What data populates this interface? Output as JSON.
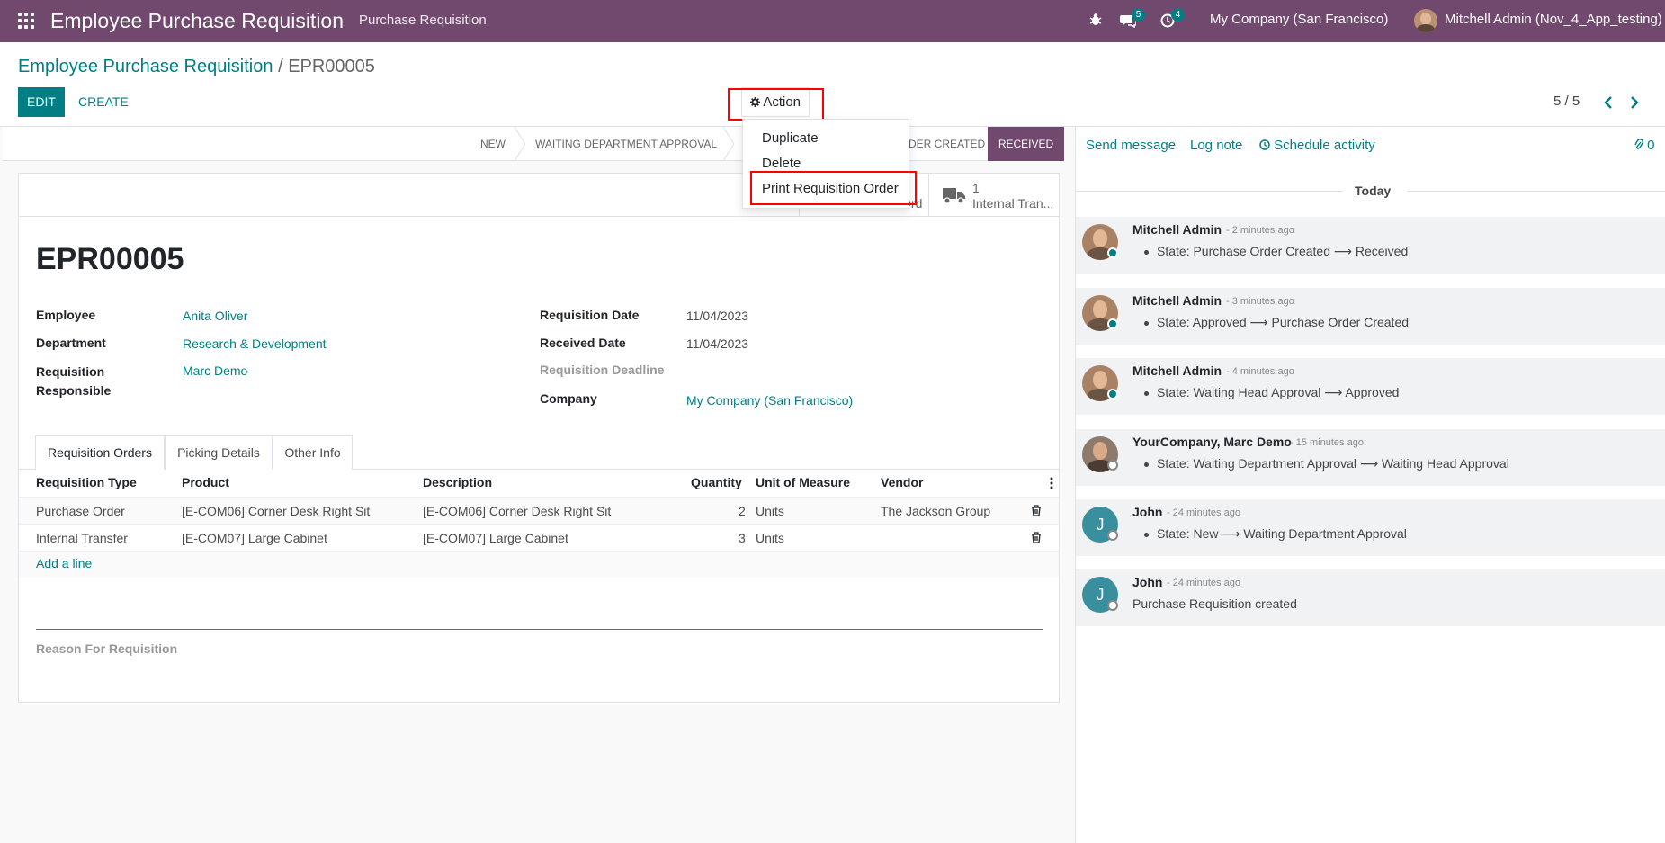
{
  "navbar": {
    "app_title": "Employee Purchase Requisition",
    "menu": "Purchase Requisition",
    "chat_count": "5",
    "activity_count": "4",
    "company": "My Company (San Francisco)",
    "user": "Mitchell Admin (Nov_4_App_testing)"
  },
  "breadcrumb": {
    "parent": "Employee Purchase Requisition",
    "separator": "/",
    "current": "EPR00005"
  },
  "toolbar": {
    "edit": "EDIT",
    "create": "CREATE",
    "action": "Action",
    "pager": "5 / 5"
  },
  "action_menu": [
    "Duplicate",
    "Delete",
    "Print Requisition Order"
  ],
  "statusbar": {
    "stages": [
      "NEW",
      "WAITING DEPARTMENT APPROVAL",
      "DER CREATED"
    ],
    "active": "RECEIVED"
  },
  "smart_buttons": {
    "purchase_partial": "Purchase Ord",
    "transfer_count": "1",
    "transfer_label": "Internal Tran..."
  },
  "form": {
    "title": "EPR00005",
    "left": [
      {
        "label": "Employee",
        "value": "Anita Oliver"
      },
      {
        "label": "Department",
        "value": "Research & Development"
      },
      {
        "label": "Requisition Responsible",
        "value": "Marc Demo"
      }
    ],
    "right": [
      {
        "label": "Requisition Date",
        "value": "11/04/2023"
      },
      {
        "label": "Received Date",
        "value": "11/04/2023"
      },
      {
        "label": "Requisition Deadline",
        "value": ""
      },
      {
        "label": "Company",
        "value": "My Company (San Francisco)"
      }
    ],
    "tabs": [
      "Requisition Orders",
      "Picking Details",
      "Other Info"
    ],
    "columns": [
      "Requisition Type",
      "Product",
      "Description",
      "Quantity",
      "Unit of Measure",
      "Vendor"
    ],
    "rows": [
      {
        "type": "Purchase Order",
        "product": "[E-COM06] Corner Desk Right Sit",
        "description": "[E-COM06] Corner Desk Right Sit",
        "quantity": "2",
        "uom": "Units",
        "vendor": "The Jackson Group"
      },
      {
        "type": "Internal Transfer",
        "product": "[E-COM07] Large Cabinet",
        "description": "[E-COM07] Large Cabinet",
        "quantity": "3",
        "uom": "Units",
        "vendor": ""
      }
    ],
    "add_line": "Add a line",
    "reason_label": "Reason For Requisition"
  },
  "chatter": {
    "send_message": "Send message",
    "log_note": "Log note",
    "schedule_activity": "Schedule activity",
    "attachments": "0",
    "day": "Today",
    "arrow": "⟶",
    "messages": [
      {
        "author": "Mitchell Admin",
        "time": "- 2 minutes ago",
        "from": "State: Purchase Order Created",
        "to": "Received"
      },
      {
        "author": "Mitchell Admin",
        "time": "- 3 minutes ago",
        "from": "State: Approved",
        "to": "Purchase Order Created"
      },
      {
        "author": "Mitchell Admin",
        "time": "- 4 minutes ago",
        "from": "State: Waiting Head Approval",
        "to": "Approved"
      },
      {
        "author": "YourCompany, Marc Demo",
        "time": "- 15 minutes ago",
        "from": "State: Waiting Department Approval",
        "to": "Waiting Head Approval"
      },
      {
        "author": "John",
        "time": "- 24 minutes ago",
        "from": "State: New",
        "to": "Waiting Department Approval"
      },
      {
        "author": "John",
        "time": "- 24 minutes ago",
        "text": "Purchase Requisition created"
      }
    ]
  },
  "colors": {
    "navbar": "#71496e",
    "accent": "#017e84",
    "highlight": "#ff0000"
  }
}
